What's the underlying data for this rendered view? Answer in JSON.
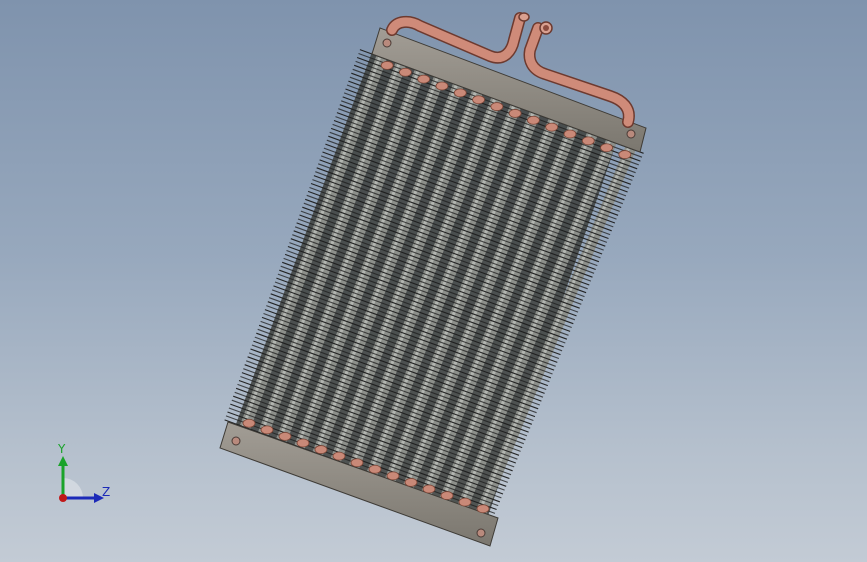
{
  "viewport": {
    "background_top": "#7f93ad",
    "background_bottom": "#c3cbd5"
  },
  "model": {
    "part": "heat-exchanger-core",
    "fin_color": "#2a2a2a",
    "tube_color": "#8a8d88",
    "plate_color": "#8e8a83",
    "copper_color": "#c98978"
  },
  "triad": {
    "y_label": "Y",
    "z_label": "Z",
    "y_color": "#1aa32a",
    "z_color": "#1c2ab8",
    "x_color": "#c01818"
  }
}
